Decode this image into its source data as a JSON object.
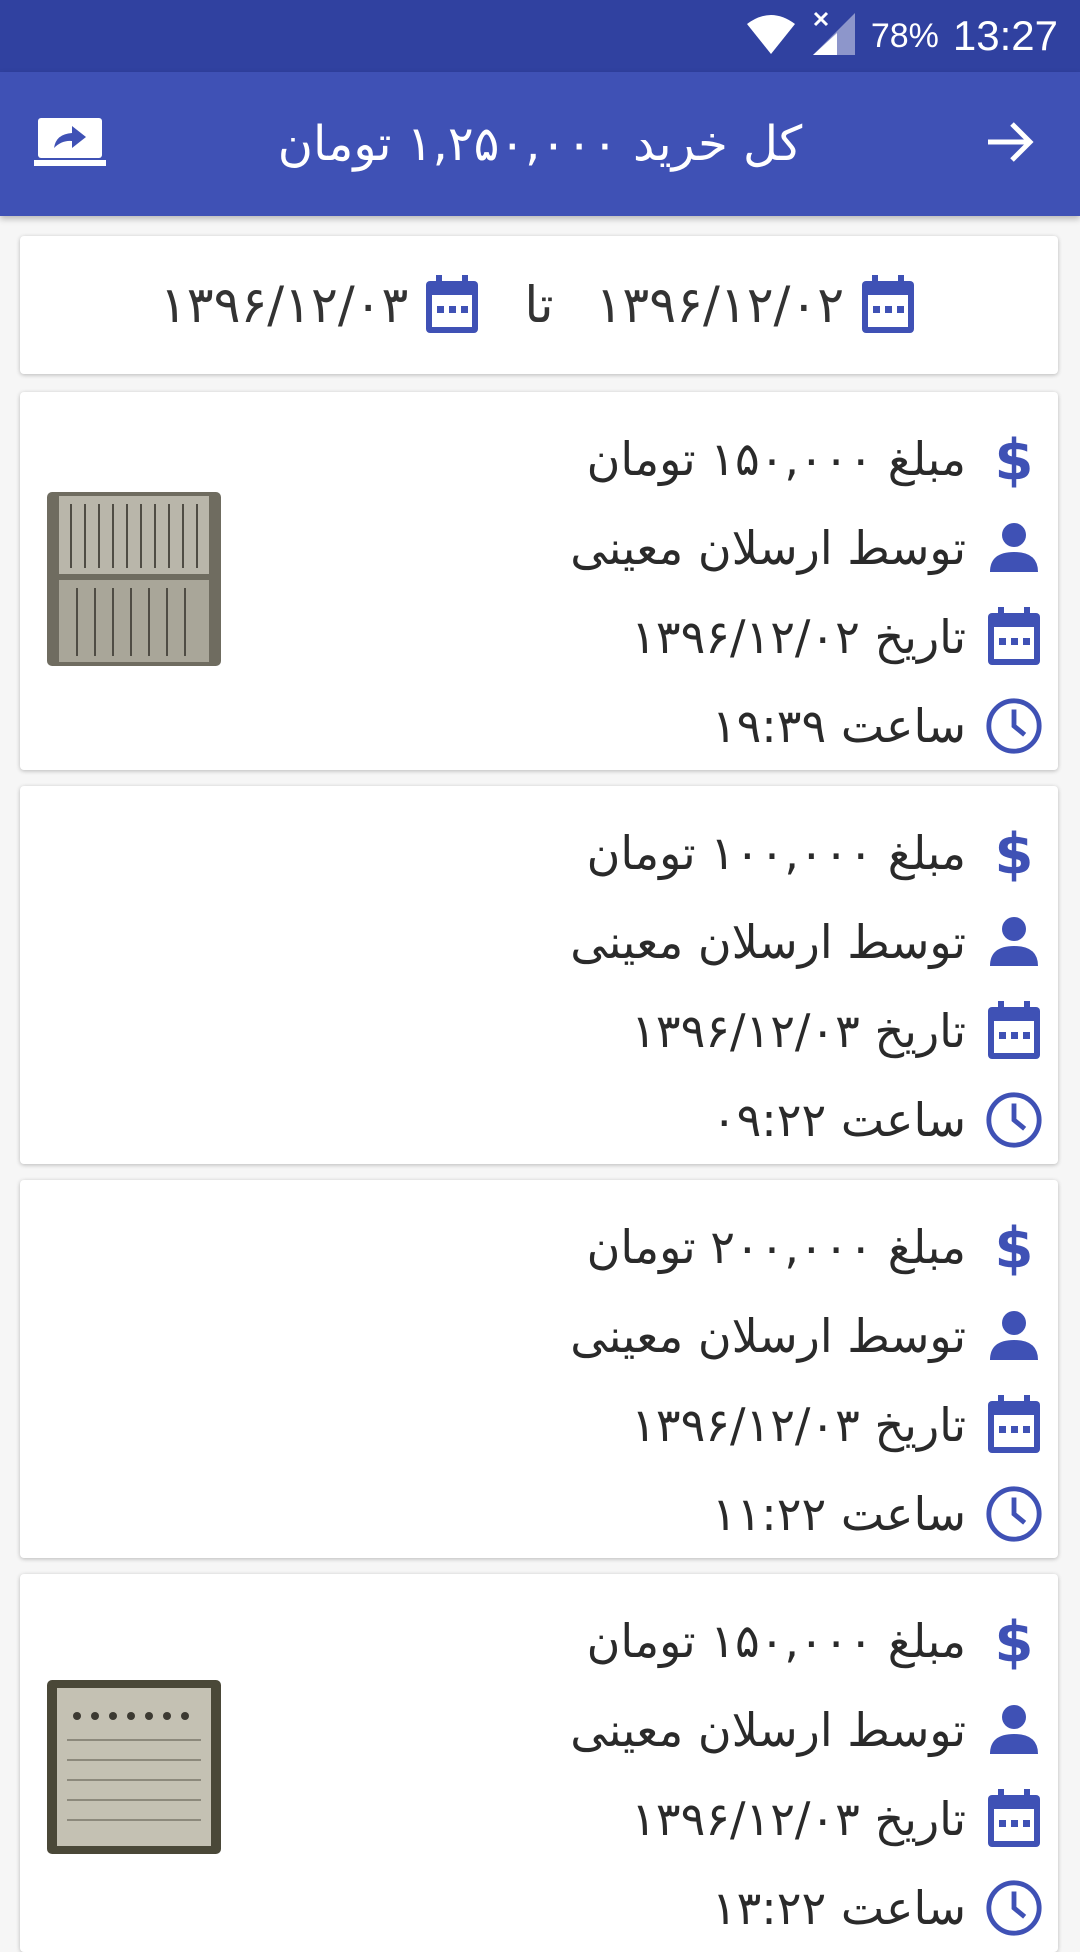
{
  "status_bar": {
    "battery": "78%",
    "time": "13:27"
  },
  "app_bar": {
    "title": "کل خرید ۱,۲۵۰,۰۰۰ تومان"
  },
  "date_range": {
    "from": "۱۳۹۶/۱۲/۰۲",
    "separator": "تا",
    "to": "۱۳۹۶/۱۲/۰۳"
  },
  "theme": {
    "primary": "#3f51b5",
    "primary_dark": "#3041a0",
    "icon_color": "#3f51b5"
  },
  "purchases": [
    {
      "amount": "مبلغ ۱۵۰,۰۰۰ تومان",
      "by": "توسط ارسلان معینی",
      "date": "تاریخ ۱۳۹۶/۱۲/۰۲",
      "time": "ساعت ۱۹:۳۹",
      "has_image": true
    },
    {
      "amount": "مبلغ ۱۰۰,۰۰۰ تومان",
      "by": "توسط ارسلان معینی",
      "date": "تاریخ ۱۳۹۶/۱۲/۰۳",
      "time": "ساعت ۰۹:۲۲",
      "has_image": false
    },
    {
      "amount": "مبلغ ۲۰۰,۰۰۰ تومان",
      "by": "توسط ارسلان معینی",
      "date": "تاریخ ۱۳۹۶/۱۲/۰۳",
      "time": "ساعت ۱۱:۲۲",
      "has_image": false
    },
    {
      "amount": "مبلغ ۱۵۰,۰۰۰ تومان",
      "by": "توسط ارسلان معینی",
      "date": "تاریخ ۱۳۹۶/۱۲/۰۳",
      "time": "ساعت ۱۳:۲۲",
      "has_image": true
    }
  ]
}
